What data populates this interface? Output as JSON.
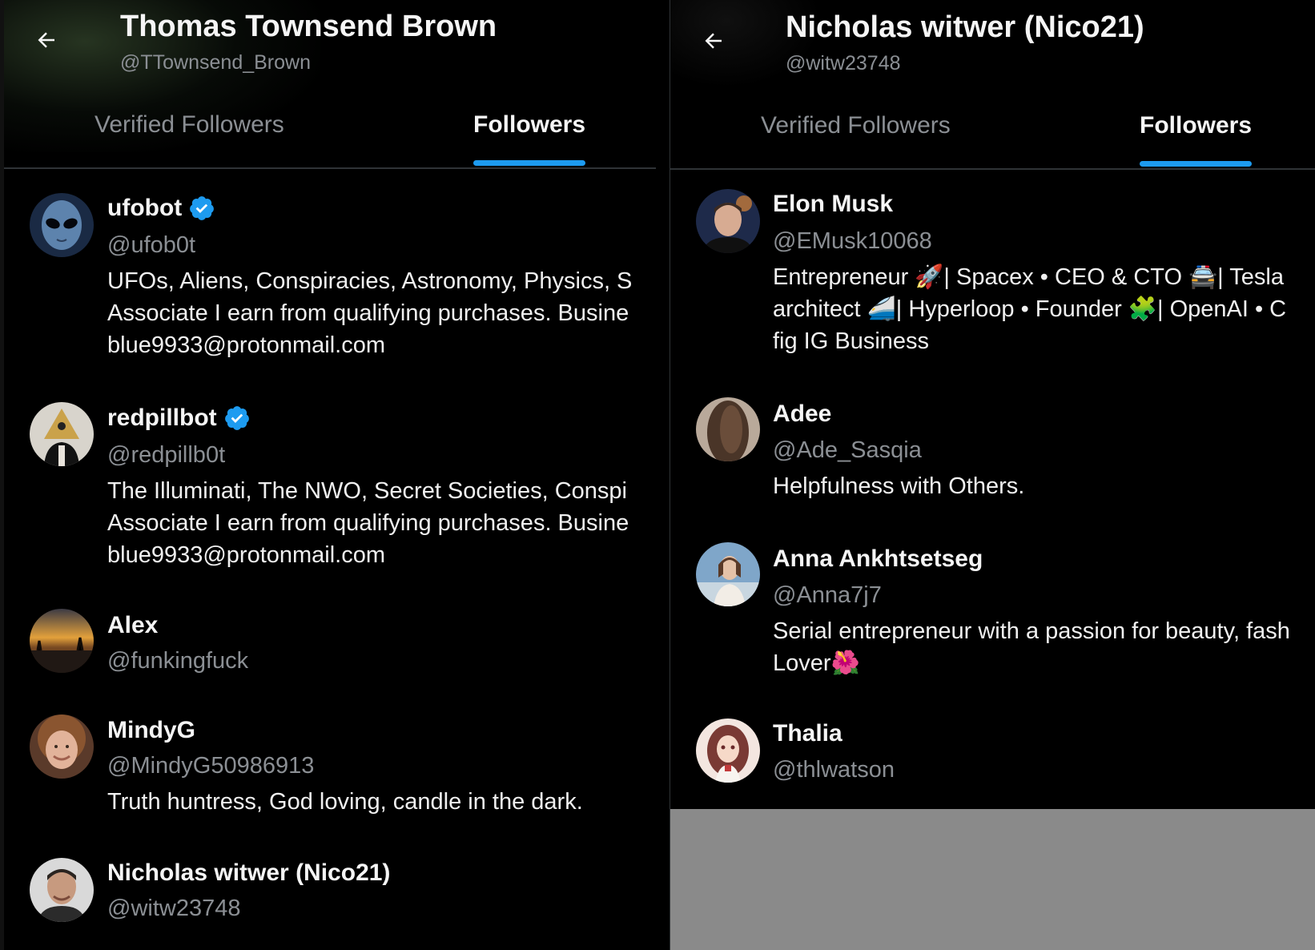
{
  "left_panel": {
    "title": "Thomas Townsend Brown",
    "handle": "@TTownsend_Brown",
    "tabs": [
      {
        "label": "Verified Followers",
        "active": false
      },
      {
        "label": "Followers",
        "active": true
      }
    ],
    "followers": [
      {
        "name": "ufobot",
        "handle": "@ufob0t",
        "verified": true,
        "bio": [
          "UFOs, Aliens, Conspiracies, Astronomy, Physics, S",
          "Associate I earn from qualifying purchases. Busine",
          "blue9933@protonmail.com"
        ]
      },
      {
        "name": "redpillbot",
        "handle": "@redpillb0t",
        "verified": true,
        "bio": [
          "The Illuminati, The NWO, Secret Societies, Conspi",
          "Associate I earn from qualifying purchases. Busine",
          "blue9933@protonmail.com"
        ]
      },
      {
        "name": "Alex",
        "handle": "@funkingfuck",
        "verified": false,
        "bio": []
      },
      {
        "name": "MindyG",
        "handle": "@MindyG50986913",
        "verified": false,
        "bio": [
          "Truth huntress, God loving, candle in the dark."
        ]
      },
      {
        "name": "Nicholas witwer (Nico21)",
        "handle": "@witw23748",
        "verified": false,
        "bio": []
      }
    ]
  },
  "right_panel": {
    "title": "Nicholas witwer (Nico21)",
    "handle": "@witw23748",
    "tabs": [
      {
        "label": "Verified Followers",
        "active": false
      },
      {
        "label": "Followers",
        "active": true
      }
    ],
    "followers": [
      {
        "name": "Elon Musk",
        "handle": "@EMusk10068",
        "verified": false,
        "bio": [
          "Entrepreneur 🚀| Spacex • CEO & CTO 🚔| Tesla",
          "architect 🚄| Hyperloop • Founder 🧩| OpenAI • C",
          "fig IG Business"
        ]
      },
      {
        "name": "Adee",
        "handle": "@Ade_Sasqia",
        "verified": false,
        "bio": [
          "Helpfulness with Others."
        ]
      },
      {
        "name": "Anna Ankhtsetseg",
        "handle": "@Anna7j7",
        "verified": false,
        "bio": [
          "Serial entrepreneur with a passion for beauty, fash",
          "Lover🌺"
        ]
      },
      {
        "name": "Thalia",
        "handle": "@thlwatson",
        "verified": false,
        "bio": []
      }
    ]
  },
  "colors": {
    "background": "#000000",
    "accent": "#1d9bf0",
    "secondary_text": "#8b8f94",
    "divider": "#2f3336",
    "overlay_gray": "#8a8a8a"
  },
  "icons": {
    "back": "arrow-left-icon",
    "verified": "verified-badge-icon"
  }
}
